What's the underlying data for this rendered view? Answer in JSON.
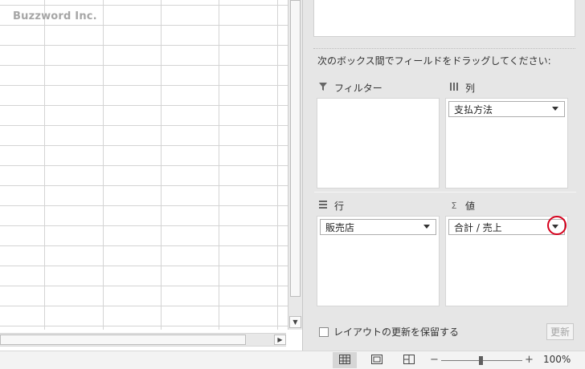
{
  "sheet": {
    "watermark": "Buzzword Inc."
  },
  "pivot_pane": {
    "instruction": "次のボックス間でフィールドをドラッグしてください:",
    "areas": {
      "filter": {
        "icon": "filter-icon",
        "title": "フィルター",
        "fields": []
      },
      "columns": {
        "icon": "columns-icon",
        "title": "列",
        "fields": [
          "支払方法"
        ]
      },
      "rows": {
        "icon": "rows-icon",
        "title": "行",
        "fields": [
          "販売店"
        ]
      },
      "values": {
        "icon": "sigma-icon",
        "title": "値",
        "fields": [
          "合計 / 売上"
        ]
      }
    },
    "defer_layout_update": {
      "label": "レイアウトの更新を保留する",
      "checked": false
    },
    "update_button": {
      "label": "更新",
      "enabled": false
    }
  },
  "statusbar": {
    "view_buttons": [
      "normal-view",
      "page-layout-view",
      "page-break-preview"
    ],
    "active_view": "normal-view",
    "zoom_minus": "−",
    "zoom_plus": "+",
    "zoom_level": "100%"
  },
  "colors": {
    "pane_background": "#e6e6e6",
    "highlight_circle": "#d6001c"
  }
}
